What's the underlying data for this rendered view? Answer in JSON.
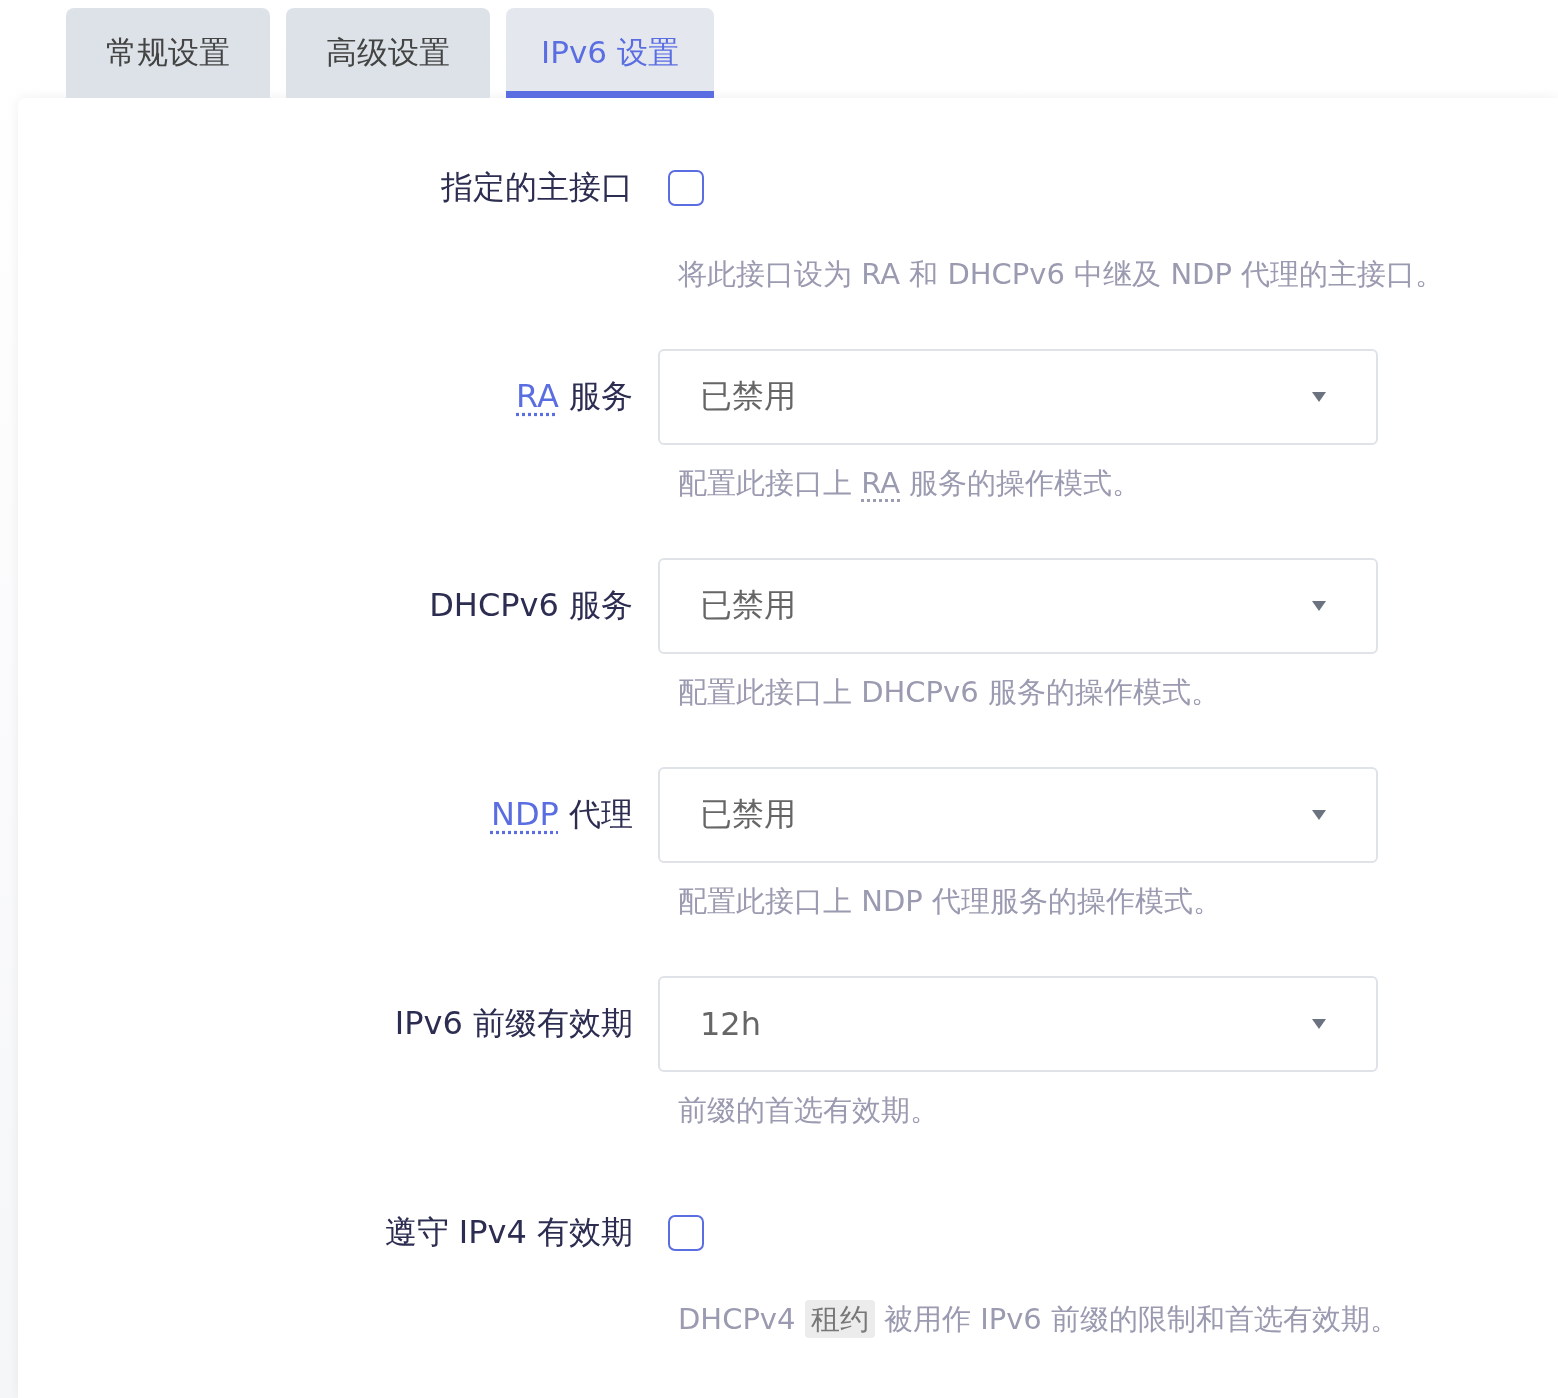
{
  "tabs": [
    {
      "label": "常规设置",
      "selected": false
    },
    {
      "label": "高级设置",
      "selected": false
    },
    {
      "label": "IPv6 设置",
      "selected": true
    }
  ],
  "fields": [
    {
      "kind": "checkbox",
      "label": [
        {
          "text": "指定的主接口",
          "kind": "plain"
        }
      ],
      "checked": false,
      "description": [
        {
          "text": "将此接口设为 RA 和 DHCPv6 中继及 NDP 代理的主接口。",
          "kind": "plain"
        }
      ]
    },
    {
      "kind": "select",
      "label": [
        {
          "text": "RA",
          "kind": "abbr"
        },
        {
          "text": " 服务",
          "kind": "plain"
        }
      ],
      "value": "已禁用",
      "description": [
        {
          "text": "配置此接口上 ",
          "kind": "plain"
        },
        {
          "text": "RA",
          "kind": "abbr"
        },
        {
          "text": " 服务的操作模式。",
          "kind": "plain"
        }
      ]
    },
    {
      "kind": "select",
      "label": [
        {
          "text": "DHCPv6 服务",
          "kind": "plain"
        }
      ],
      "value": "已禁用",
      "description": [
        {
          "text": "配置此接口上 DHCPv6 服务的操作模式。",
          "kind": "plain"
        }
      ]
    },
    {
      "kind": "select",
      "label": [
        {
          "text": "NDP",
          "kind": "abbr"
        },
        {
          "text": " 代理",
          "kind": "plain"
        }
      ],
      "value": "已禁用",
      "description": [
        {
          "text": "配置此接口上 NDP 代理服务的操作模式。",
          "kind": "plain"
        }
      ]
    },
    {
      "kind": "select",
      "label": [
        {
          "text": "IPv6 前缀有效期",
          "kind": "plain"
        }
      ],
      "value": "12h",
      "description": [
        {
          "text": "前缀的首选有效期。",
          "kind": "plain"
        }
      ]
    },
    {
      "kind": "checkbox",
      "label": [
        {
          "text": "遵守 IPv4 有效期",
          "kind": "plain"
        }
      ],
      "checked": false,
      "description": [
        {
          "text": "DHCPv4 ",
          "kind": "plain"
        },
        {
          "text": "租约",
          "kind": "code"
        },
        {
          "text": " 被用作 IPv6 前缀的限制和首选有效期。",
          "kind": "plain"
        }
      ]
    }
  ]
}
